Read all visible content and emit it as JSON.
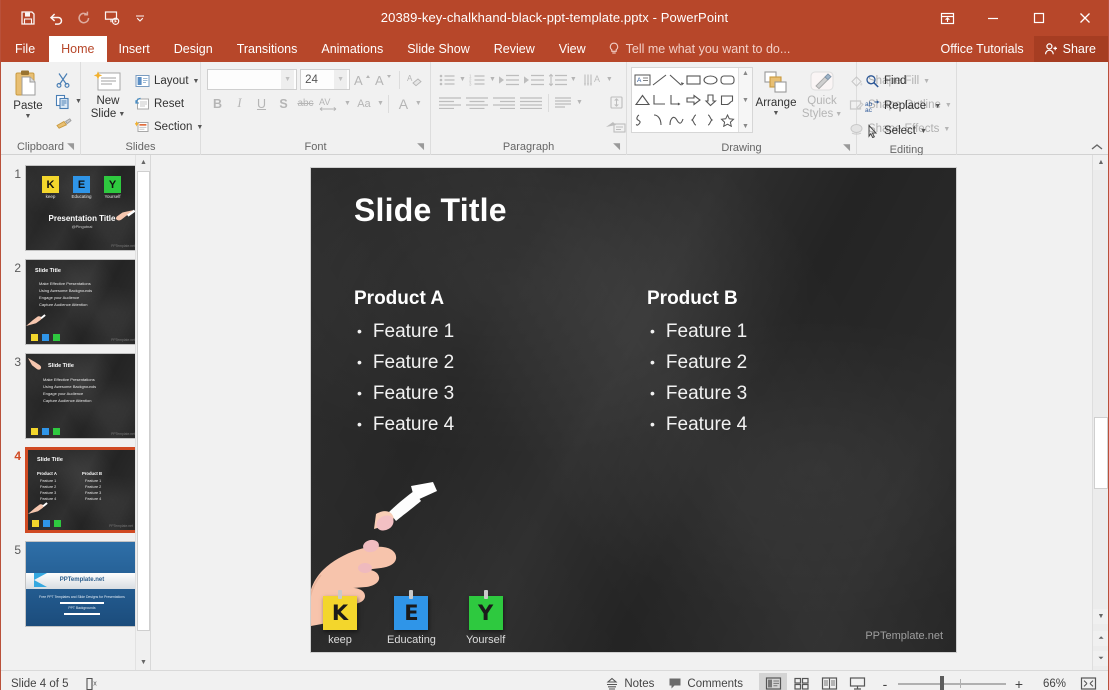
{
  "window": {
    "title": "20389-key-chalkhand-black-ppt-template.pptx - PowerPoint",
    "accent_color": "#b7472a",
    "quick_access": [
      {
        "name": "save",
        "icon": "save-icon"
      },
      {
        "name": "undo",
        "icon": "undo-icon"
      },
      {
        "name": "redo",
        "icon": "redo-icon"
      },
      {
        "name": "start-presentation",
        "icon": "presentation-icon"
      },
      {
        "name": "customize-qat",
        "icon": "chevron-down-icon"
      }
    ],
    "controls": {
      "ribbon_display": "ribbon-display-options-icon",
      "minimize": "minimize-icon",
      "restore": "restore-icon",
      "close": "close-icon"
    }
  },
  "ribbon_tabs": [
    {
      "label": "File",
      "active": false
    },
    {
      "label": "Home",
      "active": true
    },
    {
      "label": "Insert",
      "active": false
    },
    {
      "label": "Design",
      "active": false
    },
    {
      "label": "Transitions",
      "active": false
    },
    {
      "label": "Animations",
      "active": false
    },
    {
      "label": "Slide Show",
      "active": false
    },
    {
      "label": "Review",
      "active": false
    },
    {
      "label": "View",
      "active": false
    }
  ],
  "tell_me": "Tell me what you want to do...",
  "account": "Office Tutorials",
  "share_label": "Share",
  "ribbon": {
    "clipboard": {
      "label": "Clipboard",
      "paste_label": "Paste",
      "cut_label": "Cut",
      "copy_label": "Copy",
      "format_painter_label": "Format Painter"
    },
    "slides": {
      "label": "Slides",
      "new_slide_line1": "New",
      "new_slide_line2": "Slide",
      "layout_label": "Layout",
      "reset_label": "Reset",
      "section_label": "Section"
    },
    "font": {
      "label": "Font",
      "font_name_value": "",
      "font_name_placeholder": "",
      "font_size_value": "24",
      "bold": "B",
      "italic": "I",
      "underline": "U",
      "shadow": "S",
      "strikethrough": "abc",
      "char_spacing": "AV",
      "change_case": "Aa",
      "font_color": "A"
    },
    "paragraph": {
      "label": "Paragraph"
    },
    "drawing": {
      "label": "Drawing",
      "arrange_label": "Arrange",
      "quick_styles_line1": "Quick",
      "quick_styles_line2": "Styles",
      "shape_fill_label": "Shape Fill",
      "shape_outline_label": "Shape Outline",
      "shape_effects_label": "Shape Effects"
    },
    "editing": {
      "label": "Editing",
      "find_label": "Find",
      "replace_label": "Replace",
      "select_label": "Select"
    }
  },
  "thumbnails": [
    {
      "number": "1",
      "selected": false,
      "kind": "title",
      "title": "Presentation Title",
      "subtitle": "@Pingutnai",
      "notes": [
        {
          "letter": "K",
          "color": "#f3d62c",
          "caption": "keep"
        },
        {
          "letter": "E",
          "color": "#2f95e8",
          "caption": "Educating"
        },
        {
          "letter": "Y",
          "color": "#2ec93f",
          "caption": "Yourself"
        }
      ],
      "watermark": "PPTemplate.net"
    },
    {
      "number": "2",
      "selected": false,
      "kind": "bullets",
      "title": "Slide Title",
      "bullets": [
        "Make Effective Presentations",
        "Using Awesome Backgrounds",
        "Engage your Audience",
        "Capture Audience Attention"
      ],
      "watermark": "PPTemplate.net"
    },
    {
      "number": "3",
      "selected": false,
      "kind": "bullets",
      "title": "Slide Title",
      "bullets": [
        "Make Effective Presentations",
        "Using Awesome Backgrounds",
        "Engage your Audience",
        "Capture Audience Attention"
      ],
      "watermark": "PPTemplate.net"
    },
    {
      "number": "4",
      "selected": true,
      "kind": "two-column",
      "title": "Slide Title",
      "colA_head": "Product A",
      "colB_head": "Product B",
      "features": [
        "Feature 1",
        "Feature 2",
        "Feature 3",
        "Feature 4"
      ],
      "watermark": "PPTemplate.net"
    },
    {
      "number": "5",
      "selected": false,
      "kind": "blue-end",
      "title": "PPTemplate.net",
      "line1": "Free PPT Templates and Slide Designs for Presentations",
      "line2": "PPT Backgrounds"
    }
  ],
  "slide": {
    "title": "Slide Title",
    "columns": [
      {
        "heading": "Product A",
        "items": [
          "Feature 1",
          "Feature 2",
          "Feature 3",
          "Feature 4"
        ]
      },
      {
        "heading": "Product B",
        "items": [
          "Feature 1",
          "Feature 2",
          "Feature 3",
          "Feature 4"
        ]
      }
    ],
    "sticky_notes": [
      {
        "letter": "K",
        "color": "#f3d62c",
        "caption": "keep"
      },
      {
        "letter": "E",
        "color": "#2f95e8",
        "caption": "Educating"
      },
      {
        "letter": "Y",
        "color": "#2ec93f",
        "caption": "Yourself"
      }
    ],
    "watermark": "PPTemplate.net",
    "background_color": "#242424"
  },
  "status_bar": {
    "slide_indicator": "Slide 4 of 5",
    "language_icon": "spelling-icon",
    "notes_label": "Notes",
    "comments_label": "Comments",
    "views": [
      {
        "name": "normal-view",
        "active": true
      },
      {
        "name": "slide-sorter-view",
        "active": false
      },
      {
        "name": "reading-view",
        "active": false
      },
      {
        "name": "slide-show-view",
        "active": false
      }
    ],
    "zoom_out": "-",
    "zoom_in": "+",
    "zoom_percent": "66%",
    "fit_slide_icon": "fit-to-window-icon"
  }
}
